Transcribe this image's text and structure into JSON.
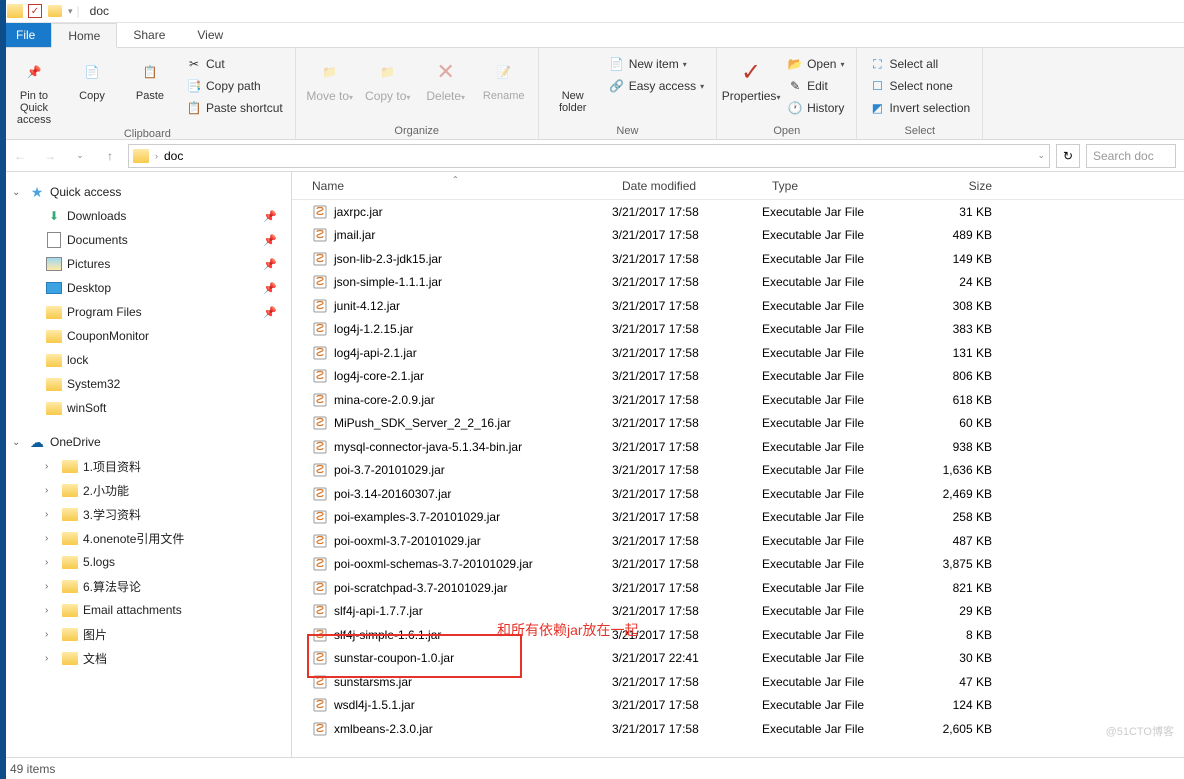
{
  "titlebar": {
    "title": "doc"
  },
  "tabs": {
    "file": "File",
    "home": "Home",
    "share": "Share",
    "view": "View"
  },
  "ribbon": {
    "clipboard": {
      "label": "Clipboard",
      "pin": "Pin to Quick access",
      "copy": "Copy",
      "paste": "Paste",
      "cut": "Cut",
      "copypath": "Copy path",
      "pasteshortcut": "Paste shortcut"
    },
    "organize": {
      "label": "Organize",
      "moveto": "Move to",
      "copyto": "Copy to",
      "delete": "Delete",
      "rename": "Rename"
    },
    "new": {
      "label": "New",
      "newfolder": "New folder",
      "newitem": "New item",
      "easyaccess": "Easy access"
    },
    "open": {
      "label": "Open",
      "properties": "Properties",
      "open": "Open",
      "edit": "Edit",
      "history": "History"
    },
    "select": {
      "label": "Select",
      "selectall": "Select all",
      "selectnone": "Select none",
      "invert": "Invert selection"
    }
  },
  "nav": {
    "path": "doc",
    "search_placeholder": "Search doc"
  },
  "sidebar": {
    "quickaccess": "Quick access",
    "items_pinned": [
      "Downloads",
      "Documents",
      "Pictures",
      "Desktop",
      "Program Files"
    ],
    "items_recent": [
      "CouponMonitor",
      "lock",
      "System32",
      "winSoft"
    ],
    "onedrive": "OneDrive",
    "onedrive_items": [
      "1.项目资料",
      "2.小功能",
      "3.学习资料",
      "4.onenote引用文件",
      "5.logs",
      "6.算法导论",
      "Email attachments",
      "图片",
      "文档"
    ]
  },
  "cols": {
    "name": "Name",
    "date": "Date modified",
    "type": "Type",
    "size": "Size"
  },
  "files": [
    {
      "name": "jaxrpc.jar",
      "date": "3/21/2017 17:58",
      "type": "Executable Jar File",
      "size": "31 KB"
    },
    {
      "name": "jmail.jar",
      "date": "3/21/2017 17:58",
      "type": "Executable Jar File",
      "size": "489 KB"
    },
    {
      "name": "json-lib-2.3-jdk15.jar",
      "date": "3/21/2017 17:58",
      "type": "Executable Jar File",
      "size": "149 KB"
    },
    {
      "name": "json-simple-1.1.1.jar",
      "date": "3/21/2017 17:58",
      "type": "Executable Jar File",
      "size": "24 KB"
    },
    {
      "name": "junit-4.12.jar",
      "date": "3/21/2017 17:58",
      "type": "Executable Jar File",
      "size": "308 KB"
    },
    {
      "name": "log4j-1.2.15.jar",
      "date": "3/21/2017 17:58",
      "type": "Executable Jar File",
      "size": "383 KB"
    },
    {
      "name": "log4j-api-2.1.jar",
      "date": "3/21/2017 17:58",
      "type": "Executable Jar File",
      "size": "131 KB"
    },
    {
      "name": "log4j-core-2.1.jar",
      "date": "3/21/2017 17:58",
      "type": "Executable Jar File",
      "size": "806 KB"
    },
    {
      "name": "mina-core-2.0.9.jar",
      "date": "3/21/2017 17:58",
      "type": "Executable Jar File",
      "size": "618 KB"
    },
    {
      "name": "MiPush_SDK_Server_2_2_16.jar",
      "date": "3/21/2017 17:58",
      "type": "Executable Jar File",
      "size": "60 KB"
    },
    {
      "name": "mysql-connector-java-5.1.34-bin.jar",
      "date": "3/21/2017 17:58",
      "type": "Executable Jar File",
      "size": "938 KB"
    },
    {
      "name": "poi-3.7-20101029.jar",
      "date": "3/21/2017 17:58",
      "type": "Executable Jar File",
      "size": "1,636 KB"
    },
    {
      "name": "poi-3.14-20160307.jar",
      "date": "3/21/2017 17:58",
      "type": "Executable Jar File",
      "size": "2,469 KB"
    },
    {
      "name": "poi-examples-3.7-20101029.jar",
      "date": "3/21/2017 17:58",
      "type": "Executable Jar File",
      "size": "258 KB"
    },
    {
      "name": "poi-ooxml-3.7-20101029.jar",
      "date": "3/21/2017 17:58",
      "type": "Executable Jar File",
      "size": "487 KB"
    },
    {
      "name": "poi-ooxml-schemas-3.7-20101029.jar",
      "date": "3/21/2017 17:58",
      "type": "Executable Jar File",
      "size": "3,875 KB"
    },
    {
      "name": "poi-scratchpad-3.7-20101029.jar",
      "date": "3/21/2017 17:58",
      "type": "Executable Jar File",
      "size": "821 KB"
    },
    {
      "name": "slf4j-api-1.7.7.jar",
      "date": "3/21/2017 17:58",
      "type": "Executable Jar File",
      "size": "29 KB"
    },
    {
      "name": "slf4j-simple-1.6.1.jar",
      "date": "3/21/2017 17:58",
      "type": "Executable Jar File",
      "size": "8 KB"
    },
    {
      "name": "sunstar-coupon-1.0.jar",
      "date": "3/21/2017 22:41",
      "type": "Executable Jar File",
      "size": "30 KB"
    },
    {
      "name": "sunstarsms.jar",
      "date": "3/21/2017 17:58",
      "type": "Executable Jar File",
      "size": "47 KB"
    },
    {
      "name": "wsdl4j-1.5.1.jar",
      "date": "3/21/2017 17:58",
      "type": "Executable Jar File",
      "size": "124 KB"
    },
    {
      "name": "xmlbeans-2.3.0.jar",
      "date": "3/21/2017 17:58",
      "type": "Executable Jar File",
      "size": "2,605 KB"
    }
  ],
  "annotation": "和所有依赖jar放在一起",
  "statusbar": "49 items",
  "watermark": "@51CTO博客"
}
